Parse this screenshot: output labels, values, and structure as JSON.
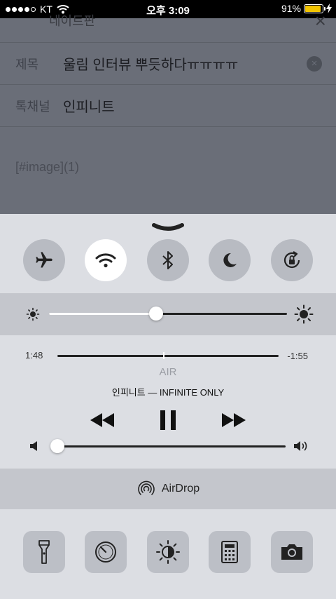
{
  "status_bar": {
    "carrier": "KT",
    "time": "오후 3:09",
    "battery": "91%",
    "battery_level": 0.91
  },
  "background_app": {
    "partial_top_text": "네이트판",
    "subject_label": "제목",
    "subject_value": "울림 인터뷰 뿌듯하다ㅠㅠㅠㅠ",
    "channel_label": "톡채널",
    "channel_value": "인피니트",
    "body_text": "[#image](1)"
  },
  "control_center": {
    "toggles": [
      {
        "name": "airplane-mode",
        "icon": "airplane-icon",
        "on": false
      },
      {
        "name": "wifi",
        "icon": "wifi-icon",
        "on": true
      },
      {
        "name": "bluetooth",
        "icon": "bluetooth-icon",
        "on": false
      },
      {
        "name": "do-not-disturb",
        "icon": "moon-icon",
        "on": false
      },
      {
        "name": "rotation-lock",
        "icon": "rotation-lock-icon",
        "on": false
      }
    ],
    "brightness_level": 0.45,
    "music": {
      "elapsed": "1:48",
      "remaining": "-1:55",
      "progress": 0.48,
      "track_title": "AIR",
      "artist_album": "인피니트 — INFINITE ONLY",
      "volume_level": 0.0
    },
    "airdrop_label": "AirDrop",
    "shortcuts": [
      {
        "name": "flashlight",
        "icon": "flashlight-icon"
      },
      {
        "name": "timer",
        "icon": "timer-icon"
      },
      {
        "name": "night-shift",
        "icon": "night-shift-icon"
      },
      {
        "name": "calculator",
        "icon": "calculator-icon"
      },
      {
        "name": "camera",
        "icon": "camera-icon"
      }
    ],
    "colors": {
      "panel_bg": "#dcdee3",
      "band_bg": "#c4c6cc",
      "toggle_off": "#b8bbc2",
      "toggle_on": "#ffffff"
    }
  }
}
